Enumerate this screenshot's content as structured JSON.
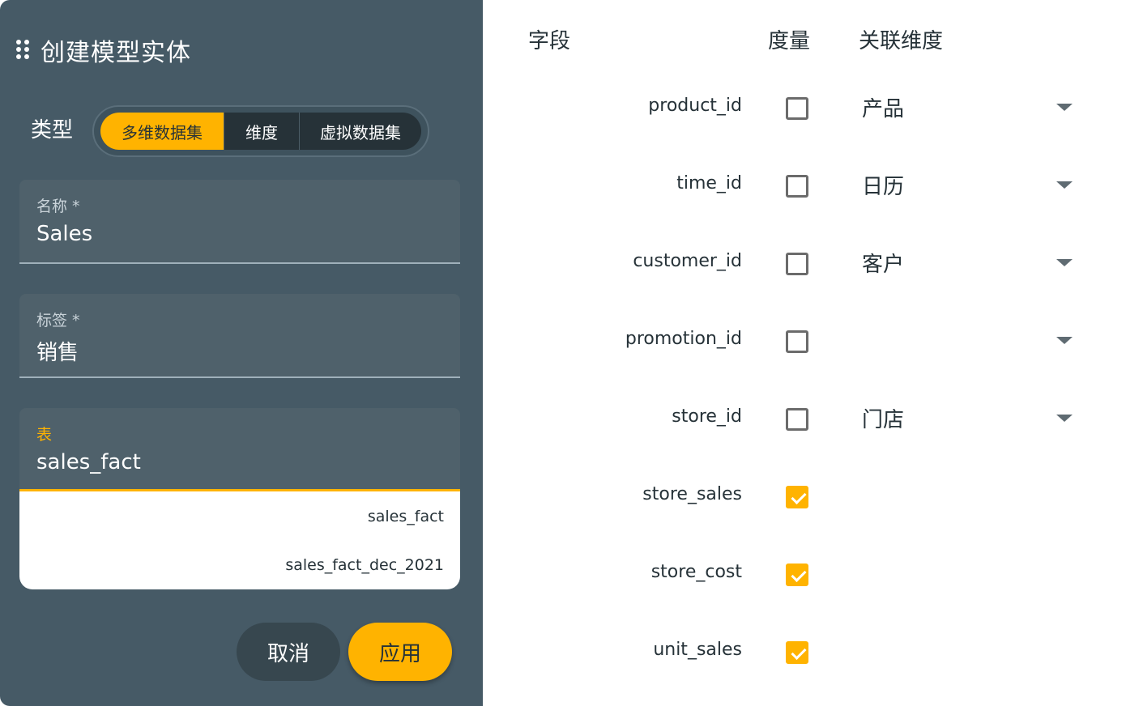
{
  "dialog": {
    "title": "创建模型实体"
  },
  "type_selector": {
    "label": "类型",
    "options": [
      "多维数据集",
      "维度",
      "虚拟数据集"
    ],
    "selected": "多维数据集"
  },
  "name_field": {
    "label": "名称 *",
    "value": "Sales"
  },
  "caption_field": {
    "label": "标签 *",
    "value": "销售"
  },
  "table_field": {
    "label": "表",
    "value": "sales_fact",
    "options": [
      "sales_fact",
      "sales_fact_dec_2021"
    ]
  },
  "actions": {
    "cancel": "取消",
    "apply": "应用"
  },
  "columns_table": {
    "headers": {
      "field": "字段",
      "measure": "度量",
      "dimension": "关联维度"
    },
    "rows": [
      {
        "field": "product_id",
        "measure": false,
        "dimension": "产品"
      },
      {
        "field": "time_id",
        "measure": false,
        "dimension": "日历"
      },
      {
        "field": "customer_id",
        "measure": false,
        "dimension": "客户"
      },
      {
        "field": "promotion_id",
        "measure": false,
        "dimension": ""
      },
      {
        "field": "store_id",
        "measure": false,
        "dimension": "门店"
      },
      {
        "field": "store_sales",
        "measure": true
      },
      {
        "field": "store_cost",
        "measure": true
      },
      {
        "field": "unit_sales",
        "measure": true
      }
    ]
  },
  "colors": {
    "panel_bg": "#465a66",
    "accent": "#ffb300",
    "field_bg": "#4f616b"
  },
  "icons": {
    "drag": "drag-handle-icon",
    "dropdown": "caret-down-icon",
    "checkbox": "check-icon"
  }
}
